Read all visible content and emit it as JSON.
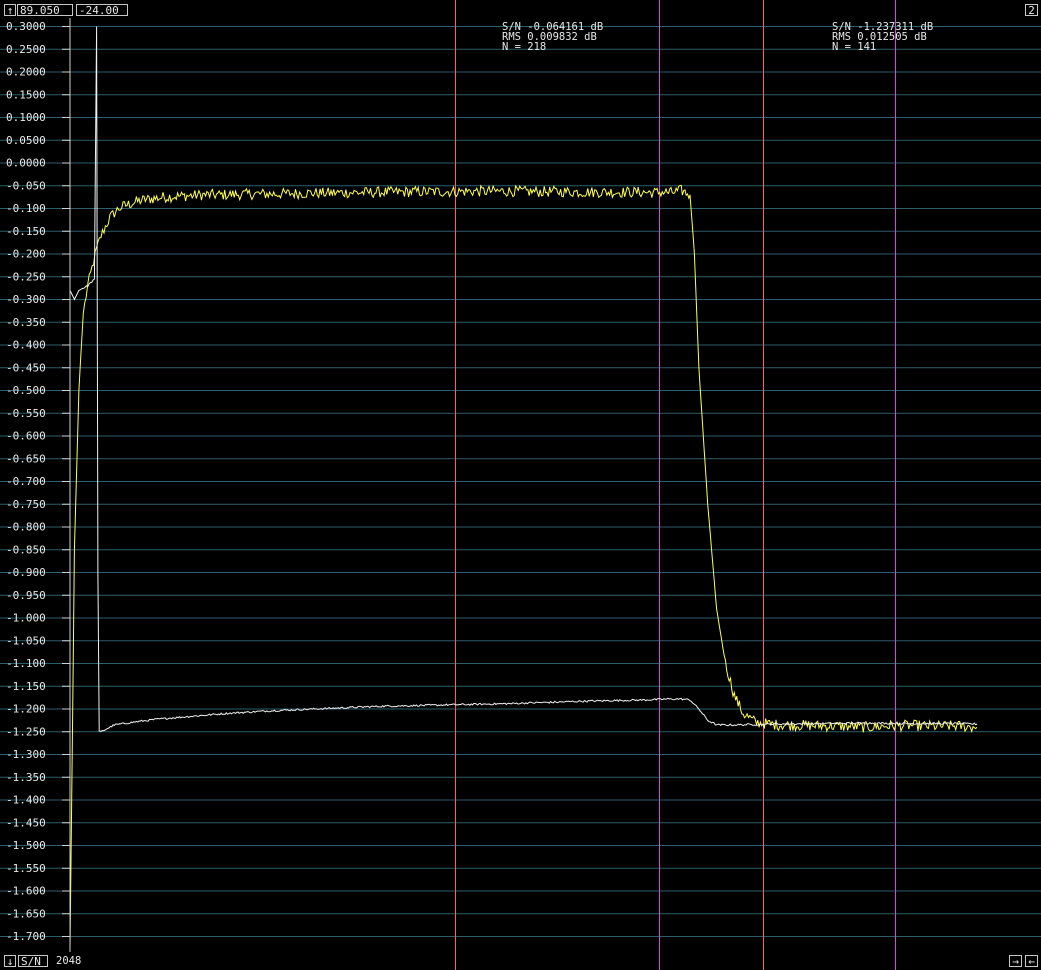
{
  "toolbar": {
    "up_icon": "arrow-up-icon",
    "x_value": "89.050",
    "y_value": "-24.00",
    "page_number": "2"
  },
  "footer": {
    "down_icon": "arrow-down-icon",
    "mode_label": "S/N",
    "count": "2048",
    "right_icon": "arrow-right-icon",
    "left_icon": "arrow-left-icon"
  },
  "colors": {
    "background": "#000000",
    "grid": "#2e5d6b",
    "axis": "#d0d0d0",
    "yellow_trace": "#ffff50",
    "white_trace": "#f0f0f0",
    "red_marker": "#ff5a6e",
    "magenta_marker": "#d04cd8"
  },
  "chart_data": {
    "type": "line",
    "ylim": [
      -1.725,
      0.3
    ],
    "y_ticks": [
      "0.3000",
      "0.2500",
      "0.2000",
      "0.1500",
      "0.1000",
      "0.0500",
      "0.0000",
      "-0.050",
      "-0.100",
      "-0.150",
      "-0.200",
      "-0.250",
      "-0.300",
      "-0.350",
      "-0.400",
      "-0.450",
      "-0.500",
      "-0.550",
      "-0.600",
      "-0.650",
      "-0.700",
      "-0.750",
      "-0.800",
      "-0.850",
      "-0.900",
      "-0.950",
      "-1.000",
      "-1.050",
      "-1.100",
      "-1.150",
      "-1.200",
      "-1.250",
      "-1.300",
      "-1.350",
      "-1.400",
      "-1.450",
      "-1.500",
      "-1.550",
      "-1.600",
      "-1.650",
      "-1.700"
    ],
    "grid": true,
    "xlim": [
      0,
      2048
    ],
    "series": [
      {
        "color": "yellow",
        "x": [
          0,
          10,
          20,
          30,
          40,
          50,
          60,
          70,
          80,
          90,
          100,
          110,
          120,
          135,
          150,
          170,
          190,
          210,
          240,
          270,
          300,
          340,
          380,
          420,
          460,
          500,
          540,
          580,
          620,
          660,
          700,
          740,
          780,
          820,
          860,
          900,
          940,
          980,
          1000,
          1040,
          1080,
          1120,
          1160,
          1200,
          1240,
          1280,
          1320,
          1340,
          1360,
          1380,
          1400,
          1410,
          1420,
          1440,
          1460,
          1480,
          1500,
          1520,
          1550,
          1600,
          1650,
          1700,
          1750,
          1800,
          1850,
          1900,
          1950,
          2000,
          2048
        ],
        "y": [
          -1.73,
          -0.85,
          -0.5,
          -0.33,
          -0.27,
          -0.23,
          -0.19,
          -0.16,
          -0.14,
          -0.12,
          -0.11,
          -0.1,
          -0.095,
          -0.09,
          -0.085,
          -0.08,
          -0.078,
          -0.075,
          -0.073,
          -0.072,
          -0.07,
          -0.07,
          -0.069,
          -0.068,
          -0.068,
          -0.067,
          -0.066,
          -0.066,
          -0.065,
          -0.065,
          -0.064,
          -0.064,
          -0.063,
          -0.063,
          -0.063,
          -0.062,
          -0.062,
          -0.062,
          -0.062,
          -0.063,
          -0.063,
          -0.063,
          -0.064,
          -0.064,
          -0.064,
          -0.064,
          -0.065,
          -0.064,
          -0.065,
          -0.06,
          -0.07,
          -0.2,
          -0.45,
          -0.75,
          -0.98,
          -1.1,
          -1.17,
          -1.21,
          -1.23,
          -1.235,
          -1.236,
          -1.237,
          -1.238,
          -1.24,
          -1.237,
          -1.236,
          -1.238,
          -1.237,
          -1.24
        ]
      },
      {
        "color": "white",
        "x": [
          0,
          10,
          20,
          40,
          55,
          60,
          63,
          66,
          70,
          80,
          100,
          150,
          200,
          250,
          300,
          350,
          400,
          450,
          500,
          550,
          600,
          650,
          700,
          750,
          800,
          850,
          900,
          950,
          1000,
          1050,
          1100,
          1150,
          1200,
          1250,
          1300,
          1350,
          1380,
          1400,
          1420,
          1440,
          1460,
          1500,
          1550,
          1600,
          1700,
          1800,
          1900,
          2000,
          2048
        ],
        "y": [
          -0.28,
          -0.3,
          -0.28,
          -0.27,
          -0.255,
          0.3,
          -0.9,
          -1.25,
          -1.25,
          -1.245,
          -1.235,
          -1.228,
          -1.222,
          -1.218,
          -1.214,
          -1.21,
          -1.207,
          -1.204,
          -1.202,
          -1.2,
          -1.198,
          -1.196,
          -1.194,
          -1.193,
          -1.192,
          -1.191,
          -1.19,
          -1.189,
          -1.188,
          -1.186,
          -1.185,
          -1.183,
          -1.182,
          -1.181,
          -1.18,
          -1.178,
          -1.178,
          -1.18,
          -1.2,
          -1.225,
          -1.235,
          -1.235,
          -1.234,
          -1.233,
          -1.232,
          -1.231,
          -1.232,
          -1.232,
          -1.233
        ]
      }
    ],
    "markers": [
      {
        "x": 870,
        "color": "red"
      },
      {
        "x": 1330,
        "color": "magenta"
      },
      {
        "x": 1565,
        "color": "red"
      },
      {
        "x": 1862,
        "color": "magenta"
      }
    ],
    "annotations": [
      {
        "sn": "S/N -0.064161 dB",
        "rms": "RMS 0.009832 dB",
        "n": "N = 218"
      },
      {
        "sn": "S/N -1.237311 dB",
        "rms": "RMS 0.012505 dB",
        "n": "N = 141"
      }
    ]
  }
}
